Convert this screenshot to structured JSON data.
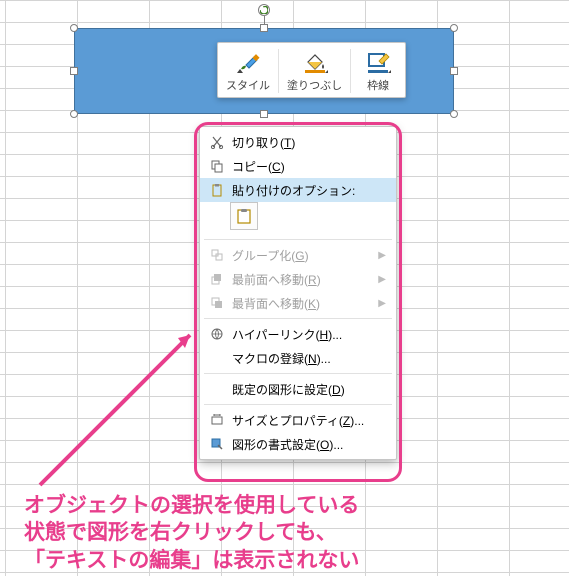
{
  "mini_toolbar": {
    "style": "スタイル",
    "fill": "塗りつぶし",
    "outline": "枠線"
  },
  "context_menu": {
    "cut": "切り取り",
    "cut_key": "T",
    "copy": "コピー",
    "copy_key": "C",
    "paste_options": "貼り付けのオプション:",
    "group": "グループ化",
    "group_key": "G",
    "bring_front": "最前面へ移動",
    "bring_front_key": "R",
    "send_back": "最背面へ移動",
    "send_back_key": "K",
    "hyperlink": "ハイパーリンク",
    "hyperlink_key": "H",
    "macro": "マクロの登録",
    "macro_key": "N",
    "set_default": "既定の図形に設定",
    "set_default_key": "D",
    "size_prop": "サイズとプロパティ",
    "size_prop_key": "Z",
    "format_shape": "図形の書式設定",
    "format_shape_key": "O"
  },
  "caption": {
    "l1": "オブジェクトの選択を使用している",
    "l2": "状態で図形を右クリックしても、",
    "l3": "「テキストの編集」は表示されない"
  }
}
